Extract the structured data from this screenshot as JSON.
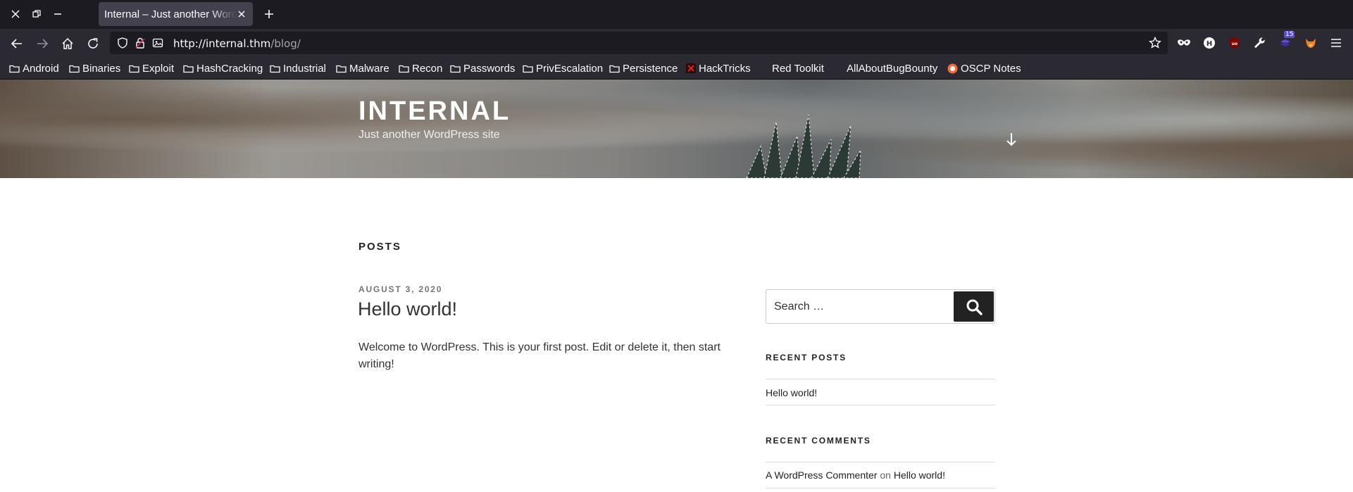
{
  "browser": {
    "tab": {
      "title": "Internal – Just another WordPress site"
    },
    "url": {
      "host": "http://internal.thm",
      "path": "/blog/"
    },
    "extensions": {
      "badge_count": "15"
    },
    "bookmarks": [
      {
        "label": "Android",
        "icon": "folder-icon"
      },
      {
        "label": "Binaries",
        "icon": "folder-icon"
      },
      {
        "label": "Exploit",
        "icon": "folder-icon"
      },
      {
        "label": "HashCracking",
        "icon": "folder-icon"
      },
      {
        "label": "Industrial",
        "icon": "folder-icon"
      },
      {
        "label": "Malware",
        "icon": "folder-icon"
      },
      {
        "label": "Recon",
        "icon": "folder-icon"
      },
      {
        "label": "Passwords",
        "icon": "folder-icon"
      },
      {
        "label": "PrivEscalation",
        "icon": "folder-icon"
      },
      {
        "label": "Persistence",
        "icon": "folder-icon"
      },
      {
        "label": "HackTricks",
        "icon": "hacktricks-icon"
      },
      {
        "label": "Red Toolkit",
        "icon": "none"
      },
      {
        "label": "AllAboutBugBounty",
        "icon": "none"
      },
      {
        "label": "OSCP Notes",
        "icon": "oscp-icon"
      }
    ]
  },
  "site": {
    "title": "INTERNAL",
    "description": "Just another WordPress site"
  },
  "main": {
    "heading": "POSTS",
    "post": {
      "date": "AUGUST 3, 2020",
      "title": "Hello world!",
      "excerpt": "Welcome to WordPress. This is your first post. Edit or delete it, then start writing!"
    }
  },
  "sidebar": {
    "search": {
      "placeholder": "Search …"
    },
    "recent_posts": {
      "title": "RECENT POSTS",
      "items": [
        "Hello world!"
      ]
    },
    "recent_comments": {
      "title": "RECENT COMMENTS",
      "author": "A WordPress Commenter",
      "on": "on",
      "post": "Hello world!"
    }
  },
  "colors": {
    "chrome_dark": "#1c1b22",
    "chrome": "#2b2a33",
    "tab_active": "#42414d",
    "text": "#333333",
    "button_dark": "#222222"
  }
}
